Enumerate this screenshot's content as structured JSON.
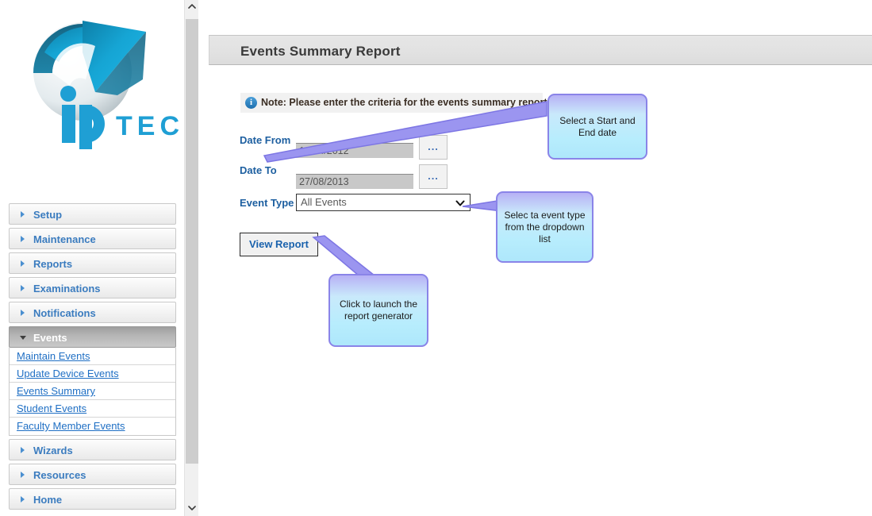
{
  "brand": {
    "name": "ip TECH",
    "wordmark": "TECH",
    "accent_color": "#1f9fd4",
    "logo_icon": "circular-arrow-sphere-logo"
  },
  "sidebar": {
    "items": [
      {
        "label": "Setup",
        "state": "collapsed",
        "icon": "chevron-right-icon"
      },
      {
        "label": "Maintenance",
        "state": "collapsed",
        "icon": "chevron-right-icon"
      },
      {
        "label": "Reports",
        "state": "collapsed",
        "icon": "chevron-right-icon"
      },
      {
        "label": "Examinations",
        "state": "collapsed",
        "icon": "chevron-right-icon"
      },
      {
        "label": "Notifications",
        "state": "collapsed",
        "icon": "chevron-right-icon"
      },
      {
        "label": "Events",
        "state": "expanded",
        "icon": "chevron-down-icon"
      },
      {
        "label": "Wizards",
        "state": "collapsed",
        "icon": "chevron-right-icon"
      },
      {
        "label": "Resources",
        "state": "collapsed",
        "icon": "chevron-right-icon"
      },
      {
        "label": "Home",
        "state": "collapsed",
        "icon": "chevron-right-icon"
      }
    ],
    "events_sub_items": [
      {
        "label": "Maintain Events"
      },
      {
        "label": "Update Device Events"
      },
      {
        "label": "Events Summary"
      },
      {
        "label": "Student Events"
      },
      {
        "label": "Faculty Member Events"
      }
    ],
    "link_color": "#1f6fc4",
    "item_text_color": "#3b7cbf",
    "active_text_color": "#ffffff"
  },
  "scrollbar": {
    "up_icon": "chevron-up-icon",
    "down_icon": "chevron-down-icon",
    "thumb": "scrollbar-thumb"
  },
  "header": {
    "title": "Events Summary Report"
  },
  "note": {
    "icon": "info-icon",
    "icon_glyph": "i",
    "text": "Note: Please enter the criteria for the events summary report."
  },
  "form": {
    "date_from": {
      "label": "Date From",
      "value": "10/04/2012",
      "picker_button_label": "...",
      "picker_icon": "ellipsis-icon"
    },
    "date_to": {
      "label": "Date To",
      "value": "27/08/2013",
      "picker_button_label": "...",
      "picker_icon": "ellipsis-icon"
    },
    "event_type": {
      "label": "Event Type",
      "value": "All Events",
      "caret_icon": "chevron-down-icon"
    },
    "submit_button": "View Report"
  },
  "callouts": [
    {
      "id": "dates",
      "text": "Select a Start and End date"
    },
    {
      "id": "event_type",
      "text": "Selec ta event type from the dropdown list"
    },
    {
      "id": "view_report",
      "text": "Click to launch the report generator"
    }
  ],
  "colors": {
    "callout_border": "#8a84e8",
    "callout_fill_top": "#b7b1f5",
    "callout_fill_bottom": "#aee7fb",
    "header_bg": "#e2e2e2",
    "note_bg": "#f1f1f1",
    "disabled_input_bg": "#c8c8c8"
  }
}
